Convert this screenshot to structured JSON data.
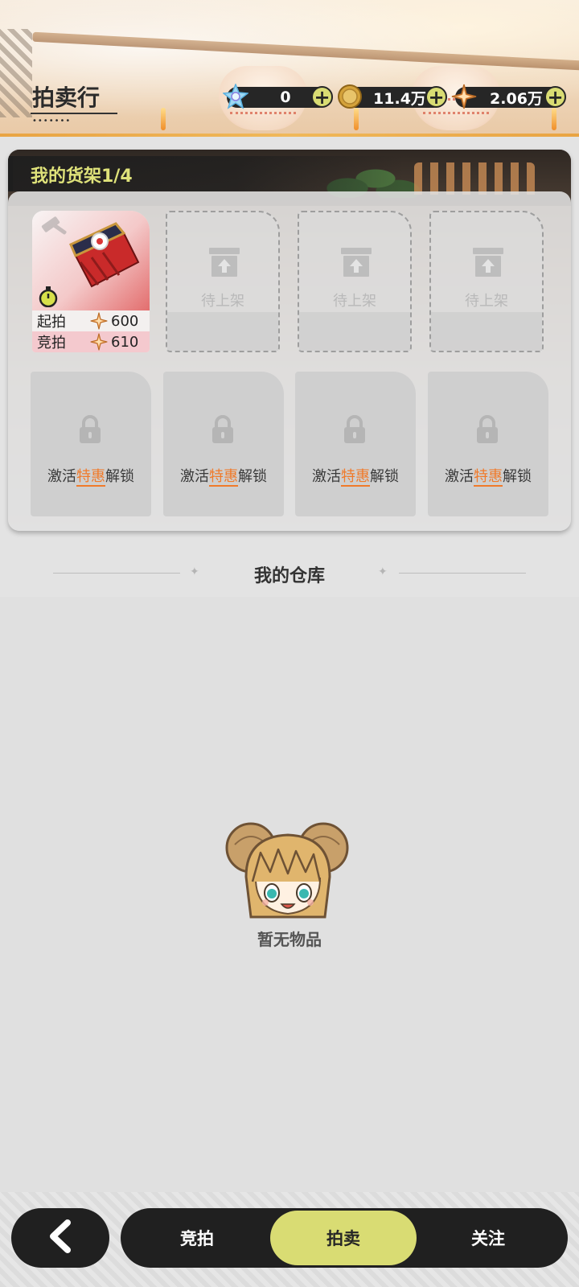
{
  "header": {
    "title": "拍卖行",
    "title_dots": "•••••••"
  },
  "currencies": [
    {
      "name": "crystal",
      "icon": "crystal-icon",
      "value": "0"
    },
    {
      "name": "coin",
      "icon": "coin-icon",
      "value": "11.4万"
    },
    {
      "name": "star-shard",
      "icon": "star-shard-icon",
      "value": "2.06万"
    }
  ],
  "shelf": {
    "title": "我的货架1/4",
    "item": {
      "start_label": "起拍",
      "start_price": "600",
      "bid_label": "竞拍",
      "bid_price": "610"
    },
    "empty_slots": [
      {
        "label": "待上架"
      },
      {
        "label": "待上架"
      },
      {
        "label": "待上架"
      }
    ],
    "locked_slots": [
      {
        "pre": "激活",
        "highlight": "特惠",
        "post": "解锁"
      },
      {
        "pre": "激活",
        "highlight": "特惠",
        "post": "解锁"
      },
      {
        "pre": "激活",
        "highlight": "特惠",
        "post": "解锁"
      },
      {
        "pre": "激活",
        "highlight": "特惠",
        "post": "解锁"
      }
    ]
  },
  "warehouse": {
    "title": "我的仓库",
    "empty_text": "暂无物品"
  },
  "bottom_nav": {
    "tabs": [
      {
        "label": "竞拍",
        "active": false
      },
      {
        "label": "拍卖",
        "active": true
      },
      {
        "label": "关注",
        "active": false
      }
    ]
  },
  "colors": {
    "accent": "#d9dc73",
    "highlight": "#f07a2a",
    "shelf_title": "#dfe27a",
    "dark": "#202020"
  }
}
